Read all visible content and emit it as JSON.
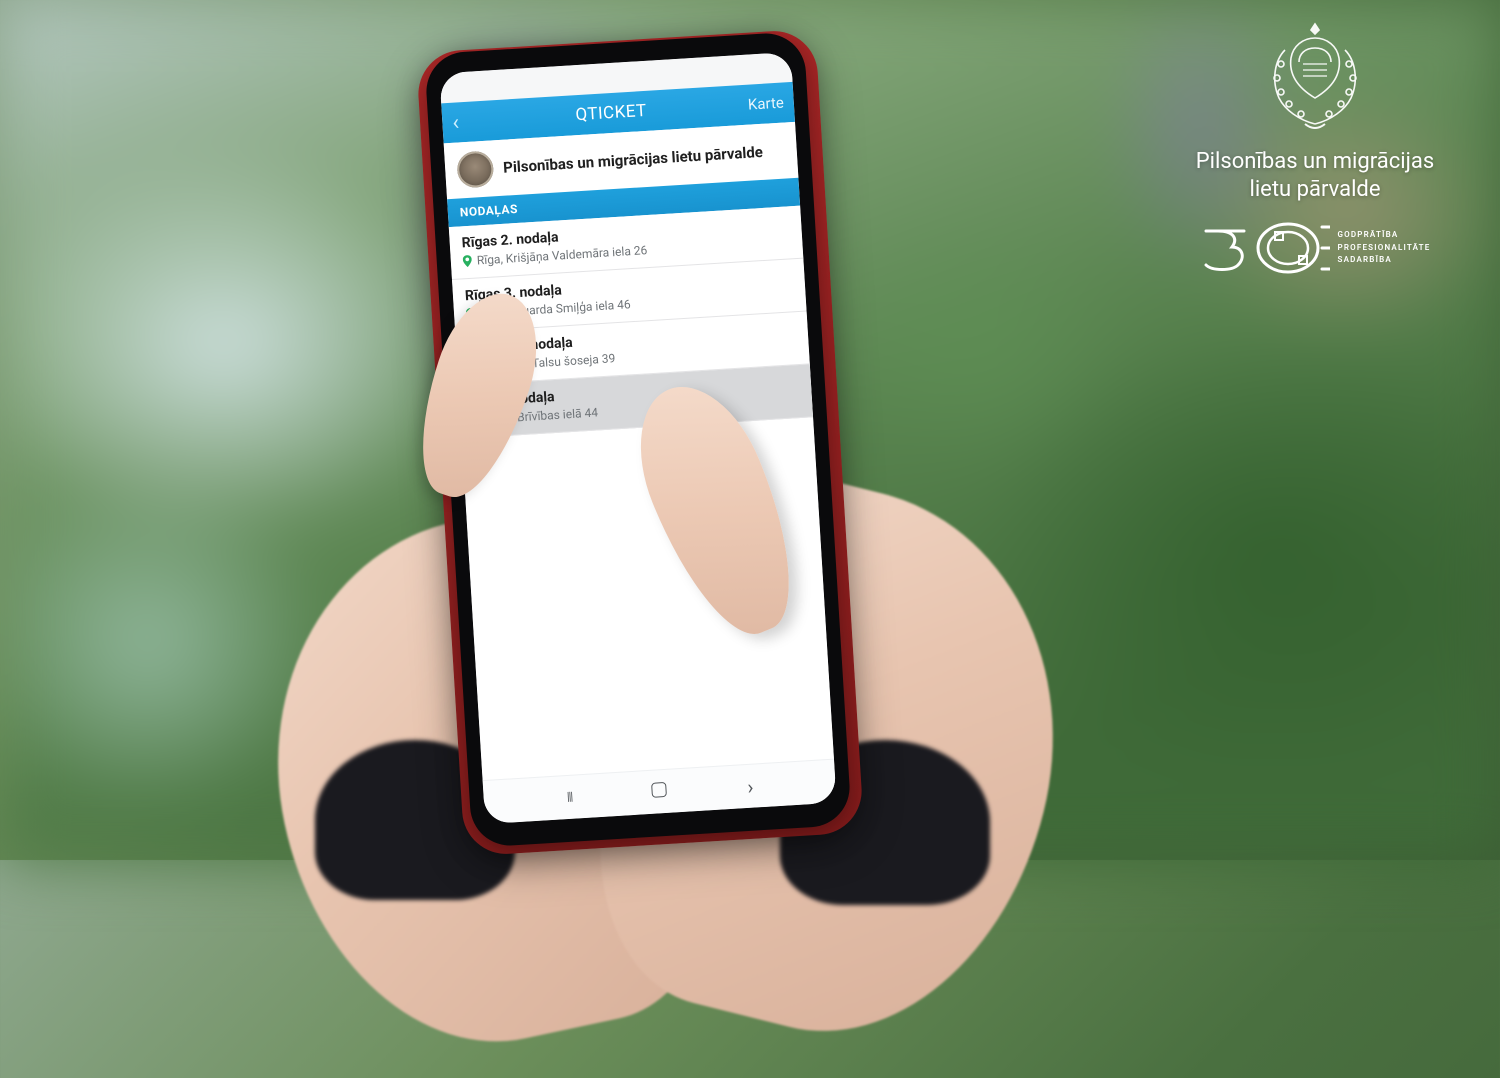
{
  "app": {
    "title": "QTICKET",
    "back_icon": "‹",
    "map_link": "Karte"
  },
  "organization": {
    "name": "Pilsonības un migrācijas lietu pārvalde"
  },
  "section": {
    "label": "NODAĻAS"
  },
  "branches": [
    {
      "name": "Rīgas 2. nodaļa",
      "address": "Rīga, Krišjāņa Valdemāra iela 26",
      "pressed": false
    },
    {
      "name": "Rīgas 3. nodaļa",
      "address": "Rīga, Eduarda Smiļģa iela 46",
      "pressed": false
    },
    {
      "name": "Jūrmalas nodaļa",
      "address": "Jūrmala, Talsu šoseja 39",
      "pressed": false
    },
    {
      "name": "Ogres nodaļa",
      "address": "Ogre, Brīvības ielā 44",
      "pressed": true
    }
  ],
  "android_nav": {
    "recents": "III",
    "back": "‹"
  },
  "overlay": {
    "org_line1": "Pilsonības un migrācijas",
    "org_line2": "lietu pārvalde",
    "values_line1": "GODPRĀTĪBA",
    "values_line2": "PROFESIONALITĀTE",
    "values_line3": "SADARBĪBA"
  },
  "colors": {
    "header_blue": "#1fa0dc",
    "pin_green": "#28b060"
  }
}
